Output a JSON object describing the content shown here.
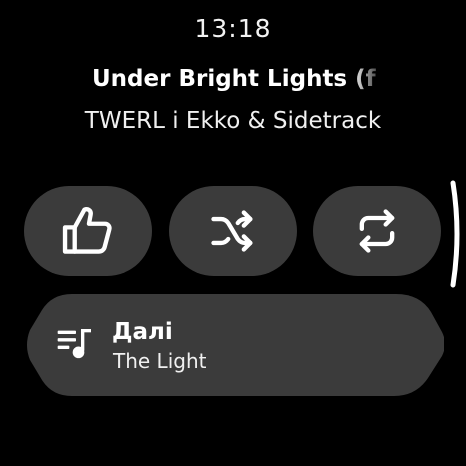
{
  "status": {
    "time": "13:18"
  },
  "now_playing": {
    "title": "Under Bright Lights (f",
    "artist": "TWERL i Ekko & Sidetrack"
  },
  "controls": [
    {
      "icon": "thumbs-up-icon"
    },
    {
      "icon": "shuffle-icon"
    },
    {
      "icon": "repeat-icon"
    }
  ],
  "up_next": {
    "icon": "queue-music-icon",
    "label": "Далі",
    "track": "The Light"
  },
  "colors": {
    "background": "#000000",
    "button": "#3b3b3b",
    "text": "#ffffff"
  }
}
